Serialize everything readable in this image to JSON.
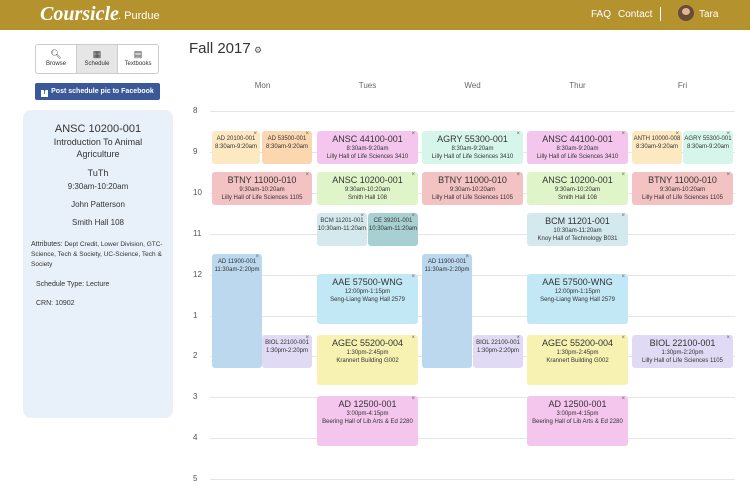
{
  "header": {
    "logo": "Coursicle",
    "school": ". Purdue",
    "faq": "FAQ",
    "contact": "Contact",
    "user": "Tara"
  },
  "tabs": [
    {
      "label": "Browse",
      "icon": "search-icon"
    },
    {
      "label": "Schedule",
      "icon": "calendar-icon"
    },
    {
      "label": "Textbooks",
      "icon": "book-icon"
    }
  ],
  "facebook_button": "Post schedule pic to Facebook",
  "selected_course": {
    "code": "ANSC 10200-001",
    "name": "Introduction To Animal Agriculture",
    "days": "TuTh",
    "time": "9:30am-10:20am",
    "instructor": "John Patterson",
    "location": "Smith Hall 108",
    "attributes_label": "Attributes:",
    "attributes_value": "Dept Credit, Lower Division, GTC-Science, Tech & Society, UC-Science, Tech & Society",
    "schedule_type_label": "Schedule Type:",
    "schedule_type_value": "Lecture",
    "crn_label": "CRN:",
    "crn_value": "10902"
  },
  "calendar": {
    "semester": "Fall 2017",
    "days": [
      "Mon",
      "Tues",
      "Wed",
      "Thur",
      "Fri"
    ],
    "hours": [
      "8",
      "9",
      "10",
      "11",
      "12",
      "1",
      "2",
      "3",
      "4",
      "5"
    ],
    "events": [
      {
        "course": "AD 20100-001",
        "time": "8:30am-9:20am",
        "location": "",
        "color": "#fde9c1"
      },
      {
        "course": "AD 53500-001",
        "time": "8:30am-9:20am",
        "location": "",
        "color": "#fbd7b0"
      },
      {
        "course": "ANSC 44100-001",
        "time": "8:30am-9:20am",
        "location": "Lilly Hall of Life Sciences 3410",
        "color": "#f4c6ee"
      },
      {
        "course": "AGRY 55300-001",
        "time": "8:30am-9:20am",
        "location": "Lilly Hall of Life Sciences 3410",
        "color": "#d6f6ec"
      },
      {
        "course": "ANSC 44100-001",
        "time": "8:30am-9:20am",
        "location": "Lilly Hall of Life Sciences 3410",
        "color": "#f4c6ee"
      },
      {
        "course": "ANTH 10000-008",
        "time": "8:30am-9:20am",
        "location": "",
        "color": "#fde9c1"
      },
      {
        "course": "AGRY 55300-001",
        "time": "8:30am-9:20am",
        "location": "",
        "color": "#d6f6ec"
      },
      {
        "course": "BTNY 11000-010",
        "time": "9:30am-10:20am",
        "location": "Lilly Hall of Life Sciences 1105",
        "color": "#f3c2c2"
      },
      {
        "course": "ANSC 10200-001",
        "time": "9:30am-10:20am",
        "location": "Smith Hall 108",
        "color": "#dff5c9"
      },
      {
        "course": "BTNY 11000-010",
        "time": "9:30am-10:20am",
        "location": "Lilly Hall of Life Sciences 1105",
        "color": "#f3c2c2"
      },
      {
        "course": "ANSC 10200-001",
        "time": "9:30am-10:20am",
        "location": "Smith Hall 108",
        "color": "#dff5c9"
      },
      {
        "course": "BTNY 11000-010",
        "time": "9:30am-10:20am",
        "location": "Lilly Hall of Life Sciences 1105",
        "color": "#f3c2c2"
      },
      {
        "course": "BCM 11201-001",
        "time": "10:30am-11:20am",
        "location": "",
        "color": "#d4e9ed"
      },
      {
        "course": "CE 39201-001",
        "time": "10:30am-11:20am",
        "location": "",
        "color": "#a8cfd1"
      },
      {
        "course": "BCM 11201-001",
        "time": "10:30am-11:20am",
        "location": "Knoy Hall of Technology B031",
        "color": "#d4e9ed"
      },
      {
        "course": "AD 11900-001",
        "time": "11:30am-2:20pm",
        "location": "",
        "color": "#bcd8ee"
      },
      {
        "course": "AD 11900-001",
        "time": "11:30am-2:20pm",
        "location": "",
        "color": "#bcd8ee"
      },
      {
        "course": "AAE 57500-WNG",
        "time": "12:00pm-1:15pm",
        "location": "Seng-Liang Wang Hall 2579",
        "color": "#c2e7f5"
      },
      {
        "course": "AAE 57500-WNG",
        "time": "12:00pm-1:15pm",
        "location": "Seng-Liang Wang Hall 2579",
        "color": "#c2e7f5"
      },
      {
        "course": "BIOL 22100-001",
        "time": "1:30pm-2:20pm",
        "location": "",
        "color": "#e1daf5"
      },
      {
        "course": "AGEC 55200-004",
        "time": "1:30pm-2:45pm",
        "location": "Krannert Building G002",
        "color": "#f8f2b2"
      },
      {
        "course": "BIOL 22100-001",
        "time": "1:30pm-2:20pm",
        "location": "",
        "color": "#e1daf5"
      },
      {
        "course": "AGEC 55200-004",
        "time": "1:30pm-2:45pm",
        "location": "Krannert Building G002",
        "color": "#f8f2b2"
      },
      {
        "course": "BIOL 22100-001",
        "time": "1:30pm-2:20pm",
        "location": "Lilly Hall of Life Sciences 1105",
        "color": "#e1daf5"
      },
      {
        "course": "AD 12500-001",
        "time": "3:00pm-4:15pm",
        "location": "Beering Hall of Lib Arts & Ed 2280",
        "color": "#f4c6ee"
      },
      {
        "course": "AD 12500-001",
        "time": "3:00pm-4:15pm",
        "location": "Beering Hall of Lib Arts & Ed 2280",
        "color": "#f4c6ee"
      }
    ]
  }
}
